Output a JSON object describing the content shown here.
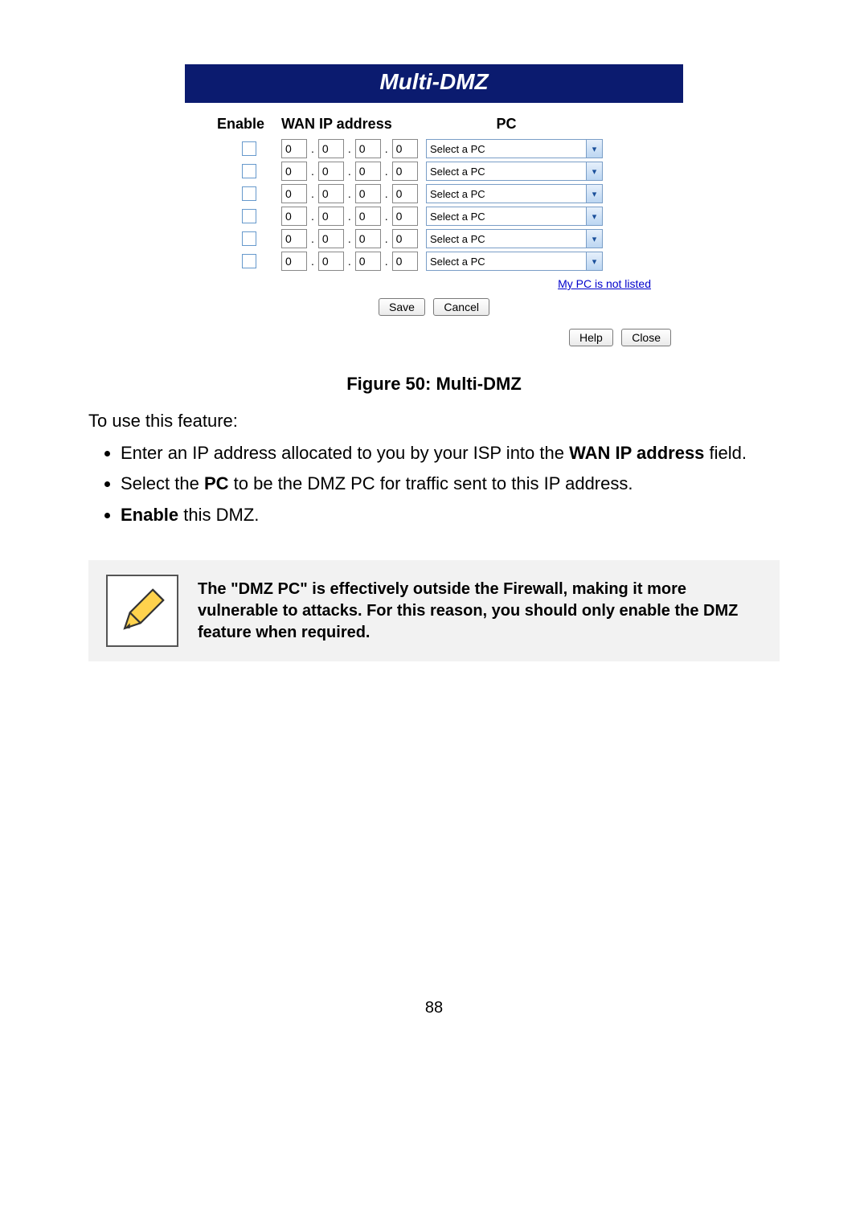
{
  "panel": {
    "title": "Multi-DMZ",
    "headers": {
      "enable": "Enable",
      "wan": "WAN IP address",
      "pc": "PC"
    },
    "rows": [
      {
        "enabled": false,
        "ip": [
          "0",
          "0",
          "0",
          "0"
        ],
        "pc": "Select a PC"
      },
      {
        "enabled": false,
        "ip": [
          "0",
          "0",
          "0",
          "0"
        ],
        "pc": "Select a PC"
      },
      {
        "enabled": false,
        "ip": [
          "0",
          "0",
          "0",
          "0"
        ],
        "pc": "Select a PC"
      },
      {
        "enabled": false,
        "ip": [
          "0",
          "0",
          "0",
          "0"
        ],
        "pc": "Select a PC"
      },
      {
        "enabled": false,
        "ip": [
          "0",
          "0",
          "0",
          "0"
        ],
        "pc": "Select a PC"
      },
      {
        "enabled": false,
        "ip": [
          "0",
          "0",
          "0",
          "0"
        ],
        "pc": "Select a PC"
      }
    ],
    "not_listed_link": "My PC is not listed",
    "save": "Save",
    "cancel": "Cancel",
    "help": "Help",
    "close": "Close"
  },
  "figure_caption": "Figure 50: Multi-DMZ",
  "intro_text": "To use this feature:",
  "bullets": [
    {
      "pre": "Enter an IP address allocated to you by your ISP into the ",
      "bold": "WAN IP address",
      "post": " field."
    },
    {
      "pre": "Select the ",
      "bold": "PC",
      "post": " to be the DMZ PC for traffic sent to this IP address."
    },
    {
      "pre": "",
      "bold": "Enable",
      "post": " this DMZ."
    }
  ],
  "note": "The \"DMZ PC\" is effectively outside the Firewall, making it more vulnerable to attacks. For this reason, you should only enable the DMZ feature when required.",
  "page_number": "88"
}
